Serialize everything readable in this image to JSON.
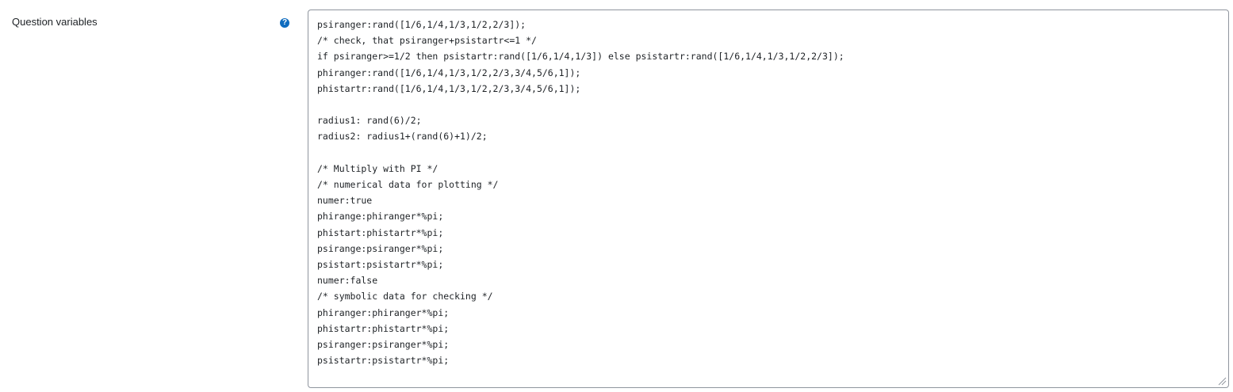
{
  "field": {
    "label": "Question variables",
    "help_icon": "question-circle-icon",
    "value": "psiranger:rand([1/6,1/4,1/3,1/2,2/3]);\n/* check, that psiranger+psistartr<=1 */\nif psiranger>=1/2 then psistartr:rand([1/6,1/4,1/3]) else psistartr:rand([1/6,1/4,1/3,1/2,2/3]);\nphiranger:rand([1/6,1/4,1/3,1/2,2/3,3/4,5/6,1]);\nphistartr:rand([1/6,1/4,1/3,1/2,2/3,3/4,5/6,1]);\n\nradius1: rand(6)/2;\nradius2: radius1+(rand(6)+1)/2;\n\n/* Multiply with PI */\n/* numerical data for plotting */\nnumer:true\nphirange:phiranger*%pi;\nphistart:phistartr*%pi;\npsirange:psiranger*%pi;\npsistart:psistartr*%pi;\nnumer:false\n/* symbolic data for checking */\nphiranger:phiranger*%pi;\nphistartr:phistartr*%pi;\npsiranger:psiranger*%pi;\npsistartr:psistartr*%pi;"
  },
  "colors": {
    "help_icon": "#0f6cbf",
    "border": "#8f959e",
    "text": "#1d2125"
  }
}
